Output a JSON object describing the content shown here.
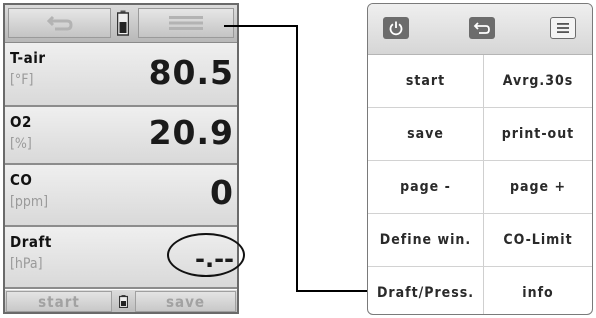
{
  "device": {
    "top_bar": {
      "back_icon": "back-arrow-icon",
      "battery_icon": "battery-icon",
      "menu_icon": "menu-lines-icon"
    },
    "rows": [
      {
        "label": "T-air",
        "unit": "[°F]",
        "value": "80.5"
      },
      {
        "label": "O2",
        "unit": "[%]",
        "value": "20.9"
      },
      {
        "label": "CO",
        "unit": "[ppm]",
        "value": "0"
      },
      {
        "label": "Draft",
        "unit": "[hPa]",
        "value": "-.--"
      }
    ],
    "bottom_bar": {
      "start_label": "start",
      "save_label": "save"
    }
  },
  "menu_panel": {
    "icons": [
      "power-icon",
      "back-icon",
      "menu-icon"
    ],
    "items": [
      [
        "start",
        "Avrg.30s"
      ],
      [
        "save",
        "print-out"
      ],
      [
        "page -",
        "page +"
      ],
      [
        "Define win.",
        "CO-Limit"
      ],
      [
        "Draft/Press.",
        "info"
      ]
    ]
  },
  "colors": {
    "screen_gray": "#d9d9d9",
    "icon_dark": "#6c6c6c",
    "text": "#1a1a1a",
    "muted": "#9a9a9a"
  }
}
